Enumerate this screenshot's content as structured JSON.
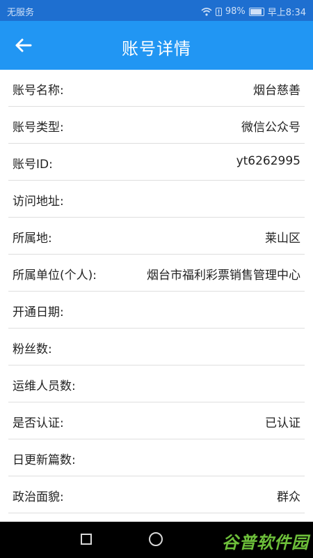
{
  "status_bar": {
    "carrier": "无服务",
    "battery": "98%",
    "time": "早上8:34"
  },
  "header": {
    "title": "账号详情"
  },
  "details": [
    {
      "label": "账号名称:",
      "value": "烟台慈善"
    },
    {
      "label": "账号类型:",
      "value": "微信公众号"
    },
    {
      "label": "账号ID:",
      "value": "yt6262995"
    },
    {
      "label": "访问地址:",
      "value": ""
    },
    {
      "label": "所属地:",
      "value": "莱山区"
    },
    {
      "label": "所属单位(个人):",
      "value": "烟台市福利彩票销售管理中心"
    },
    {
      "label": "开通日期:",
      "value": ""
    },
    {
      "label": "粉丝数:",
      "value": ""
    },
    {
      "label": "运维人员数:",
      "value": ""
    },
    {
      "label": "是否认证:",
      "value": "已认证"
    },
    {
      "label": "日更新篇数:",
      "value": ""
    },
    {
      "label": "政治面貌:",
      "value": "群众"
    }
  ],
  "nav_bar": {
    "watermark": "谷普软件园"
  }
}
